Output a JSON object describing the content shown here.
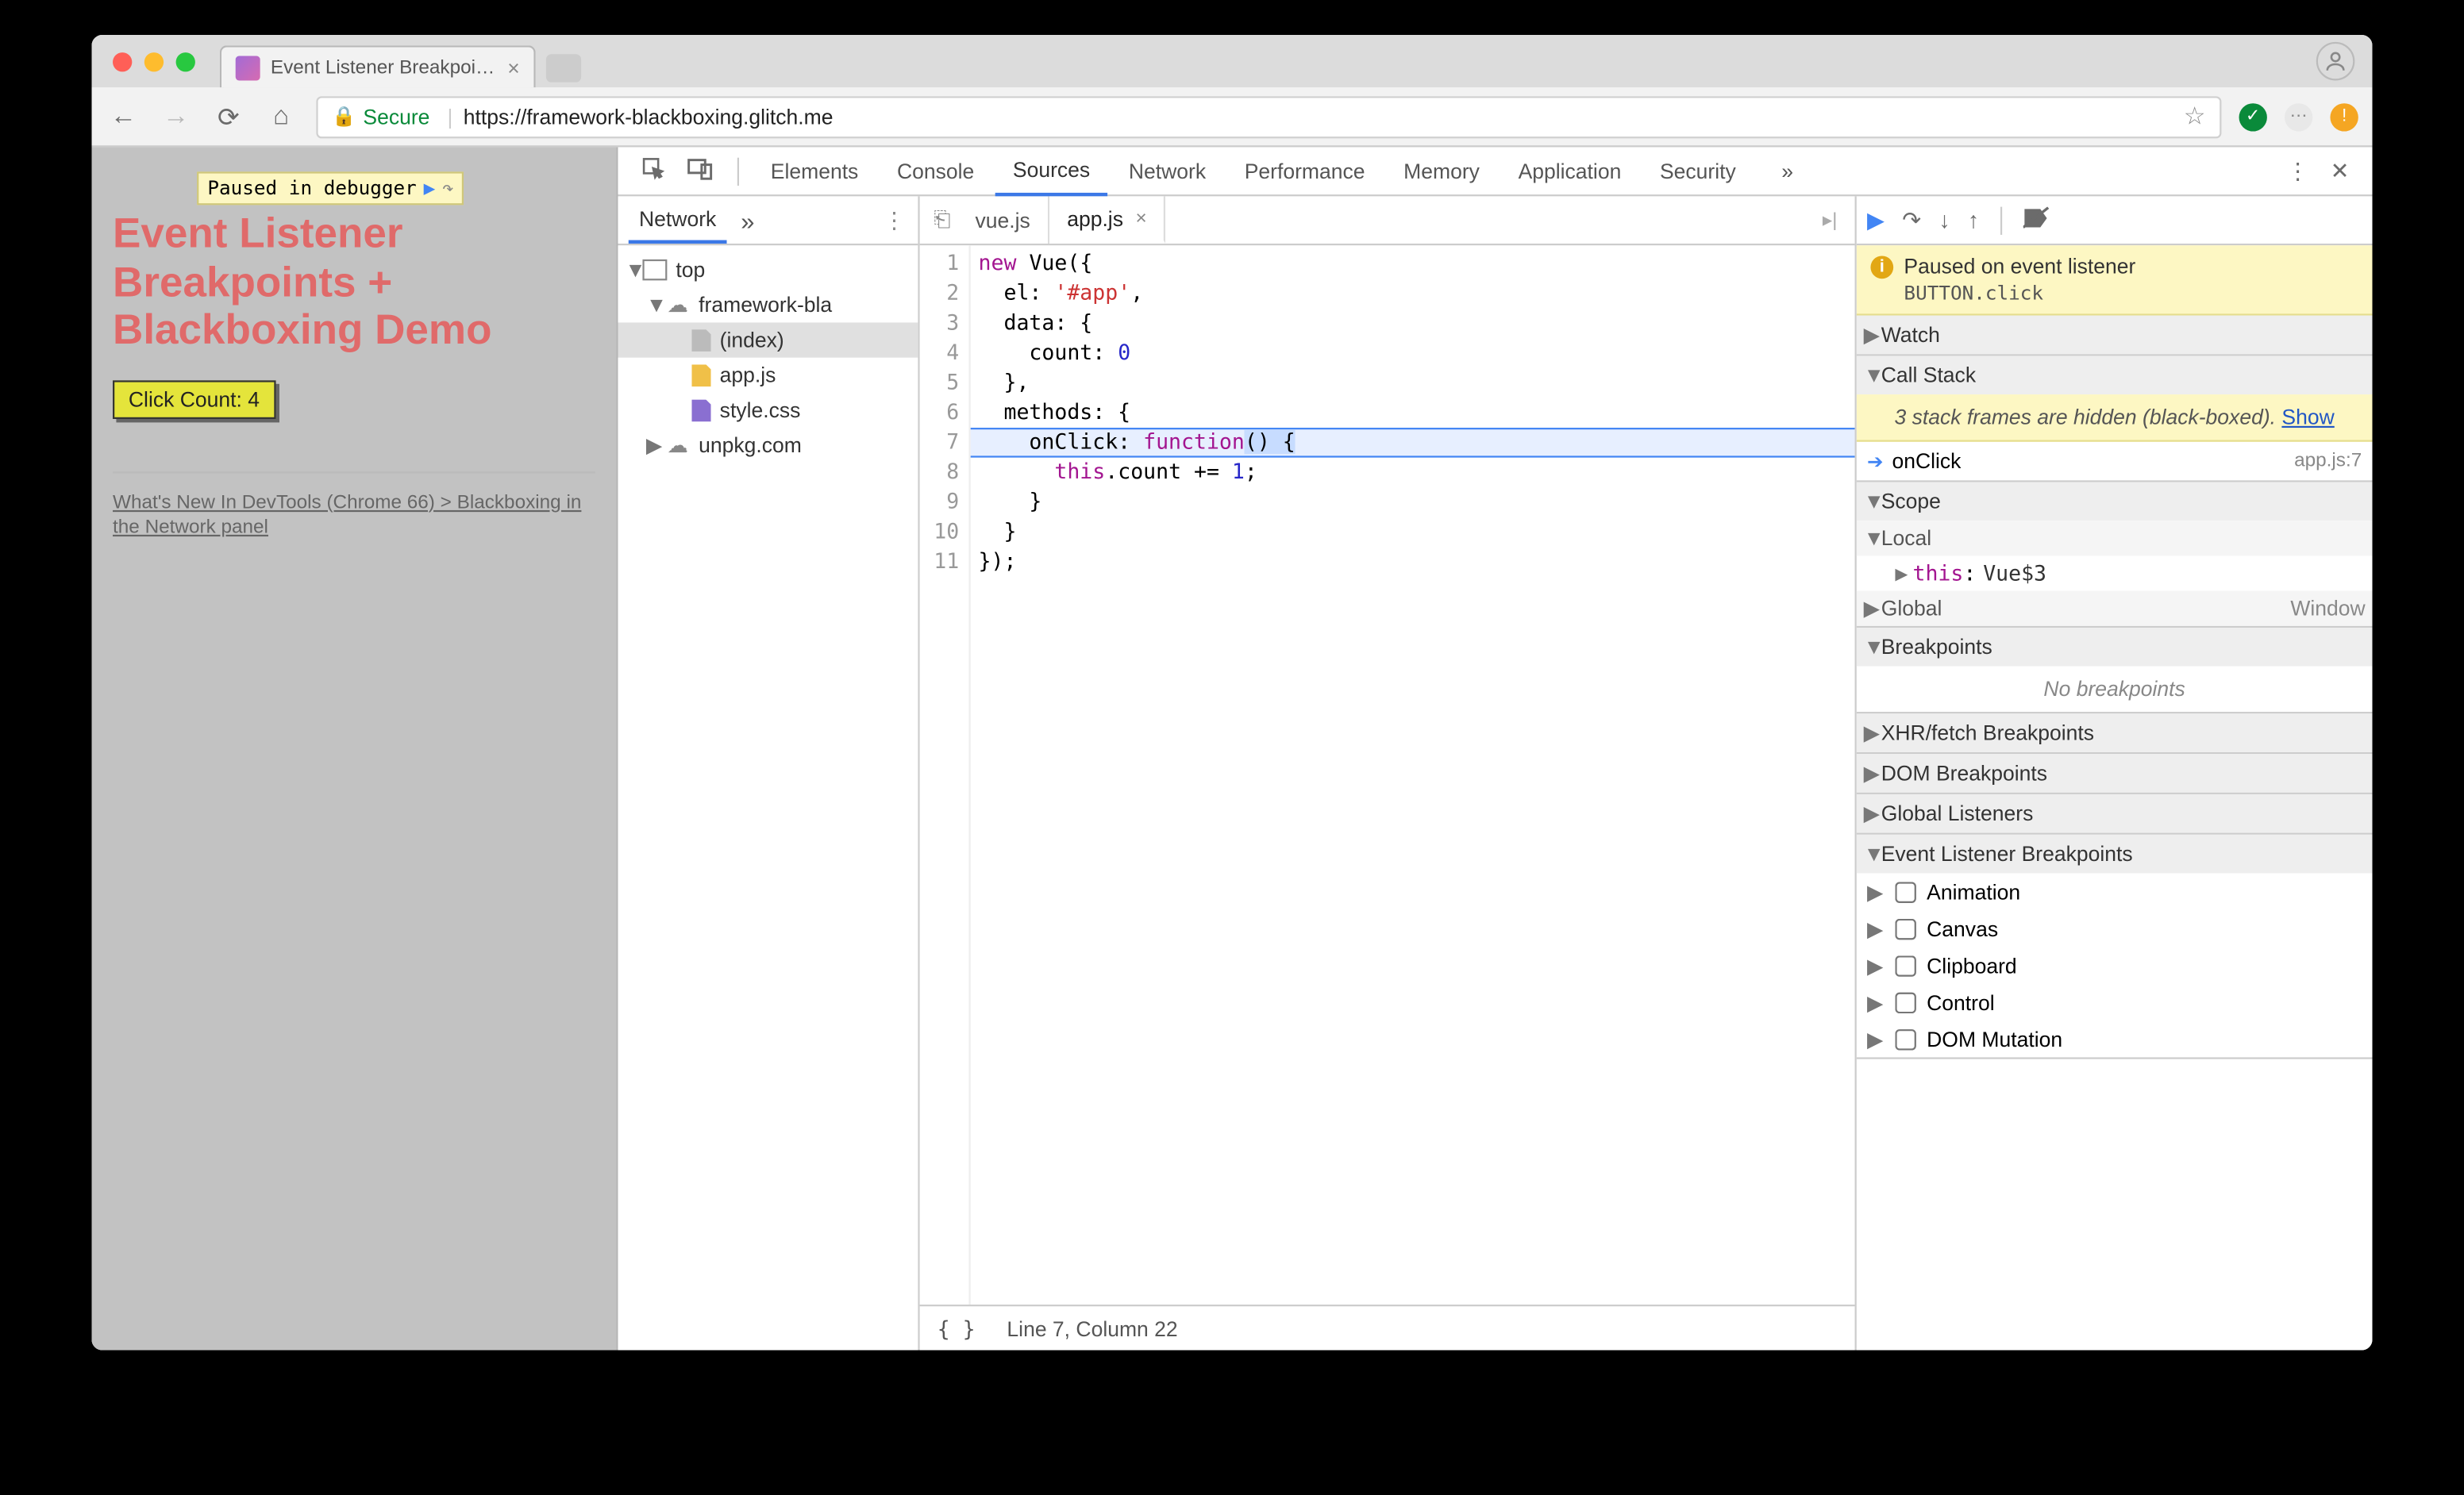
{
  "browser": {
    "tab_title": "Event Listener Breakpoints + B",
    "secure_label": "Secure",
    "url_host": "https://framework-blackboxing.glitch.me",
    "url_path": ""
  },
  "pause_overlay": "Paused in debugger",
  "page": {
    "heading": "Event Listener Breakpoints + Blackboxing Demo",
    "button": "Click Count: 4",
    "link": "What's New In DevTools (Chrome 66) > Blackboxing in the Network panel"
  },
  "devtools": {
    "tabs": [
      "Elements",
      "Console",
      "Sources",
      "Network",
      "Performance",
      "Memory",
      "Application",
      "Security"
    ],
    "active_tab": "Sources",
    "nav_tab": "Network",
    "tree": {
      "top": "top",
      "domain": "framework-bla",
      "files": [
        "(index)",
        "app.js",
        "style.css"
      ],
      "cdn": "unpkg.com"
    },
    "editor": {
      "open_tabs": [
        "vue.js",
        "app.js"
      ],
      "active": "app.js",
      "status": "Line 7, Column 22",
      "code_lines": [
        "new Vue({",
        "  el: '#app',",
        "  data: {",
        "    count: 0",
        "  },",
        "  methods: {",
        "    onClick: function() {",
        "      this.count += 1;",
        "    }",
        "  }",
        "});"
      ]
    },
    "debugger": {
      "banner_title": "Paused on event listener",
      "banner_detail": "BUTTON.click",
      "sections": {
        "watch": "Watch",
        "callstack": "Call Stack",
        "scope": "Scope",
        "breakpoints": "Breakpoints",
        "xhr": "XHR/fetch Breakpoints",
        "dom": "DOM Breakpoints",
        "global": "Global Listeners",
        "elb": "Event Listener Breakpoints"
      },
      "cs_hidden_msg": "3 stack frames are hidden (black-boxed).",
      "cs_show": "Show",
      "cs_frame": "onClick",
      "cs_src": "app.js:7",
      "scope_local": "Local",
      "scope_this_name": "this",
      "scope_this_val": "Vue$3",
      "scope_global": "Global",
      "scope_global_val": "Window",
      "no_bp": "No breakpoints",
      "elb_items": [
        "Animation",
        "Canvas",
        "Clipboard",
        "Control",
        "DOM Mutation"
      ]
    }
  }
}
